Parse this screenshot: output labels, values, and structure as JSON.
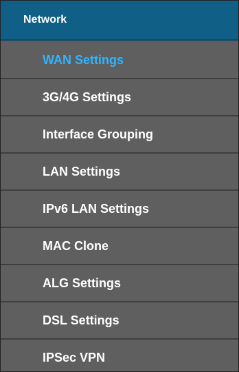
{
  "menu": {
    "header": "Network",
    "active_color": "#2fb4ff",
    "header_color": "#0f5f86",
    "item_bg_color": "#5f5f5f",
    "items": [
      {
        "label": "WAN Settings",
        "active": true
      },
      {
        "label": "3G/4G Settings",
        "active": false
      },
      {
        "label": "Interface Grouping",
        "active": false
      },
      {
        "label": "LAN Settings",
        "active": false
      },
      {
        "label": "IPv6 LAN Settings",
        "active": false
      },
      {
        "label": "MAC Clone",
        "active": false
      },
      {
        "label": "ALG Settings",
        "active": false
      },
      {
        "label": "DSL Settings",
        "active": false
      },
      {
        "label": "IPSec VPN",
        "active": false
      }
    ]
  }
}
